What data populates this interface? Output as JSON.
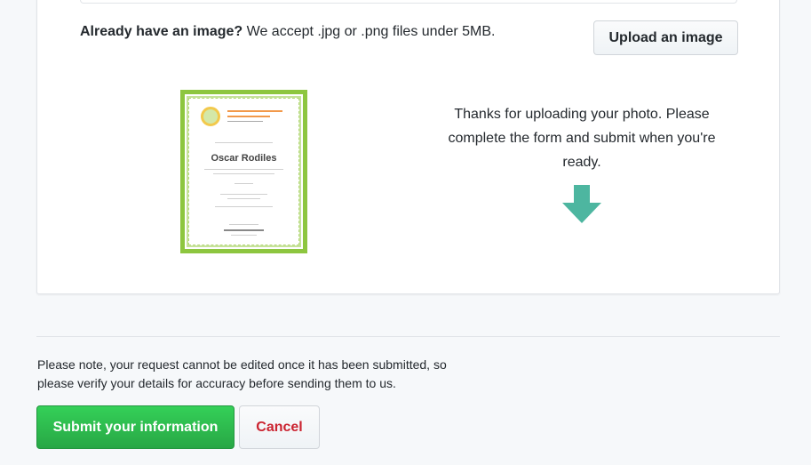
{
  "upload": {
    "prompt_bold": "Already have an image?",
    "prompt_text": " We accept .jpg or .png files under 5MB.",
    "button_label": "Upload an image"
  },
  "preview": {
    "recipient_name": "Oscar Rodiles",
    "status_message": "Thanks for uploading your photo. Please complete the form and submit when you're ready.",
    "arrow_color": "#4db6a0",
    "arrow_icon": "arrow-down-icon"
  },
  "footer": {
    "note": "Please note, your request cannot be edited once it has been submitted, so please verify your details for accuracy before sending them to us.",
    "submit_label": "Submit your information",
    "cancel_label": "Cancel"
  },
  "colors": {
    "submit_green": "#28a745",
    "cancel_red": "#cb2431",
    "certificate_border": "#8dc63f"
  }
}
